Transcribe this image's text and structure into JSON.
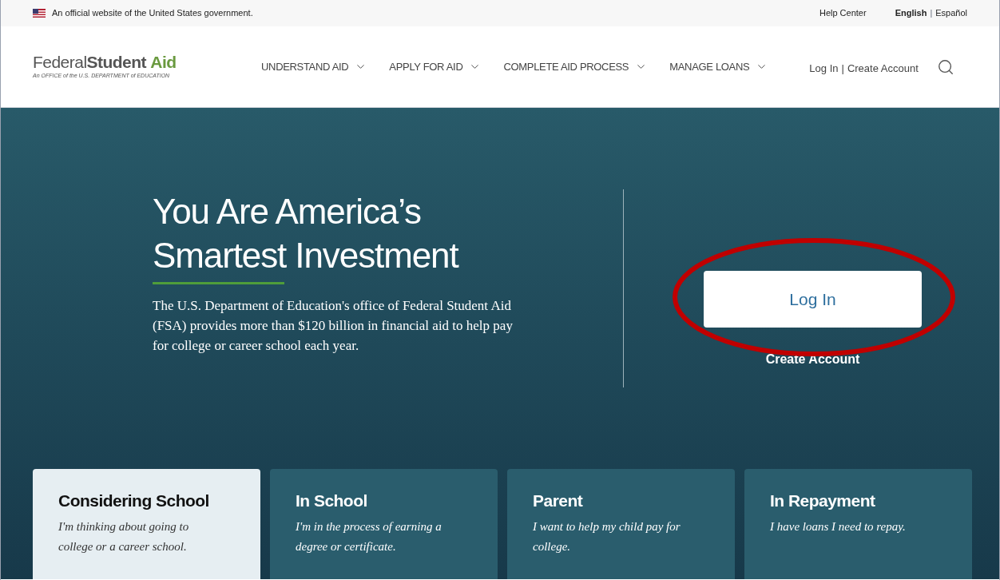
{
  "gov_banner": {
    "text": "An official website of the United States government."
  },
  "utility_links": {
    "help": "Help Center",
    "separator": "|",
    "languages": [
      {
        "label": "English",
        "selected": true
      },
      {
        "label": "Español",
        "selected": false
      }
    ]
  },
  "logo": {
    "name_light": "Federal",
    "name_bold": "Student",
    "name_accent": "Aid",
    "tagline": "An OFFICE of the U.S. DEPARTMENT of EDUCATION"
  },
  "nav": [
    {
      "label": "UNDERSTAND AID"
    },
    {
      "label": "APPLY FOR AID"
    },
    {
      "label": "COMPLETE AID PROCESS"
    },
    {
      "label": "MANAGE LOANS"
    }
  ],
  "account_links": [
    "Log In",
    "Create Account"
  ],
  "account_separator": "|",
  "hero": {
    "title_lines": [
      "You Are America’s",
      "Smartest Investment"
    ],
    "text": "The U.S. Department of Education's office of Federal Student Aid (FSA) provides more than $120 billion in financial aid to help pay for college or career school each year.",
    "login_button": "Log In",
    "create_account": "Create Account"
  },
  "cards": [
    {
      "title": "Considering School",
      "text": "I'm thinking about going to college or a career school.",
      "selected": true
    },
    {
      "title": "In School",
      "text": "I'm in the process of earning a degree or certificate.",
      "selected": false
    },
    {
      "title": "Parent",
      "text": "I want to help my child pay for college.",
      "selected": false
    },
    {
      "title": "In Repayment",
      "text": "I have loans I need to repay.",
      "selected": false
    }
  ]
}
